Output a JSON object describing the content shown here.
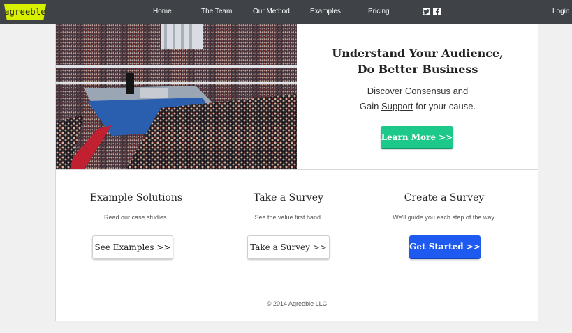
{
  "navbar": {
    "logo": "agreeble",
    "links": [
      "Home",
      "The Team",
      "Our Method",
      "Examples",
      "Pricing"
    ],
    "social": [
      "twitter-icon",
      "facebook-icon"
    ],
    "login": "Login",
    "bg_color": "#3f4347",
    "logo_color": "#d6f000"
  },
  "hero": {
    "title_line1": "Understand Your Audience,",
    "title_line2": "Do Better Business",
    "sub_pre1": "Discover ",
    "sub_link1": "Consensus",
    "sub_post1": " and",
    "sub_pre2": "Gain ",
    "sub_link2": "Support",
    "sub_post2": " for your cause.",
    "button": "Learn More >>",
    "button_color": "#1dc98a"
  },
  "columns": [
    {
      "title": "Example Solutions",
      "desc": "Read our case studies.",
      "button": "See Examples >>"
    },
    {
      "title": "Take a Survey",
      "desc": "See the value first hand.",
      "button": "Take a Survey >>"
    },
    {
      "title": "Create a Survey",
      "desc": "We'll guide you each step of the way.",
      "button": "Get Started >>",
      "button_color": "#1e5af0"
    }
  ],
  "footer": "© 2014 Agreeble LLC"
}
